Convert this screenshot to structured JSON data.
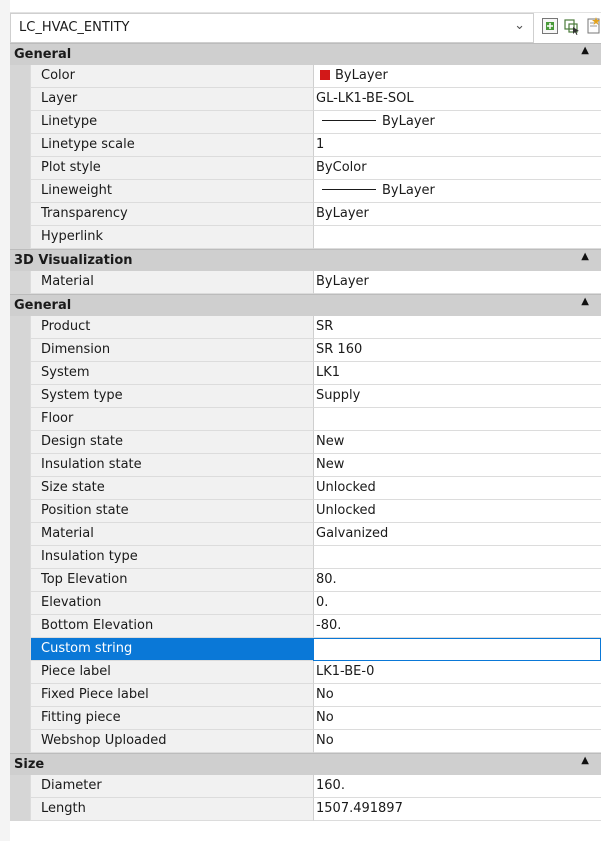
{
  "entity_selector": {
    "value": "LC_HVAC_ENTITY"
  },
  "toolbar": {
    "chevron_icon": "chevron-down-icon",
    "buttons": [
      "toggle-pickadd-icon",
      "select-objects-icon",
      "quick-select-icon"
    ]
  },
  "categories": [
    {
      "title": "General",
      "rows": [
        {
          "name": "Color",
          "value": "ByLayer",
          "swatch": "#d21818"
        },
        {
          "name": "Layer",
          "value": "GL-LK1-BE-SOL"
        },
        {
          "name": "Linetype",
          "value": "ByLayer",
          "linesample": true
        },
        {
          "name": "Linetype scale",
          "value": "1"
        },
        {
          "name": "Plot style",
          "value": "ByColor"
        },
        {
          "name": "Lineweight",
          "value": "ByLayer",
          "linesample": true
        },
        {
          "name": "Transparency",
          "value": "ByLayer"
        },
        {
          "name": "Hyperlink",
          "value": ""
        }
      ]
    },
    {
      "title": "3D Visualization",
      "rows": [
        {
          "name": "Material",
          "value": "ByLayer"
        }
      ]
    },
    {
      "title": "General",
      "rows": [
        {
          "name": "Product",
          "value": "SR"
        },
        {
          "name": "Dimension",
          "value": "SR 160"
        },
        {
          "name": "System",
          "value": "LK1"
        },
        {
          "name": "System type",
          "value": "Supply"
        },
        {
          "name": "Floor",
          "value": ""
        },
        {
          "name": "Design state",
          "value": "New"
        },
        {
          "name": "Insulation state",
          "value": "New"
        },
        {
          "name": "Size state",
          "value": "Unlocked"
        },
        {
          "name": "Position state",
          "value": "Unlocked"
        },
        {
          "name": "Material",
          "value": "Galvanized"
        },
        {
          "name": "Insulation type",
          "value": ""
        },
        {
          "name": "Top Elevation",
          "value": "80."
        },
        {
          "name": "Elevation",
          "value": "0."
        },
        {
          "name": "Bottom Elevation",
          "value": "-80."
        },
        {
          "name": "Custom string",
          "value": "",
          "selected": true
        },
        {
          "name": "Piece label",
          "value": "LK1-BE-0"
        },
        {
          "name": "Fixed Piece label",
          "value": "No"
        },
        {
          "name": "Fitting piece",
          "value": "No"
        },
        {
          "name": "Webshop Uploaded",
          "value": "No"
        }
      ]
    },
    {
      "title": "Size",
      "rows": [
        {
          "name": "Diameter",
          "value": "160."
        },
        {
          "name": "Length",
          "value": "1507.491897"
        }
      ]
    }
  ]
}
